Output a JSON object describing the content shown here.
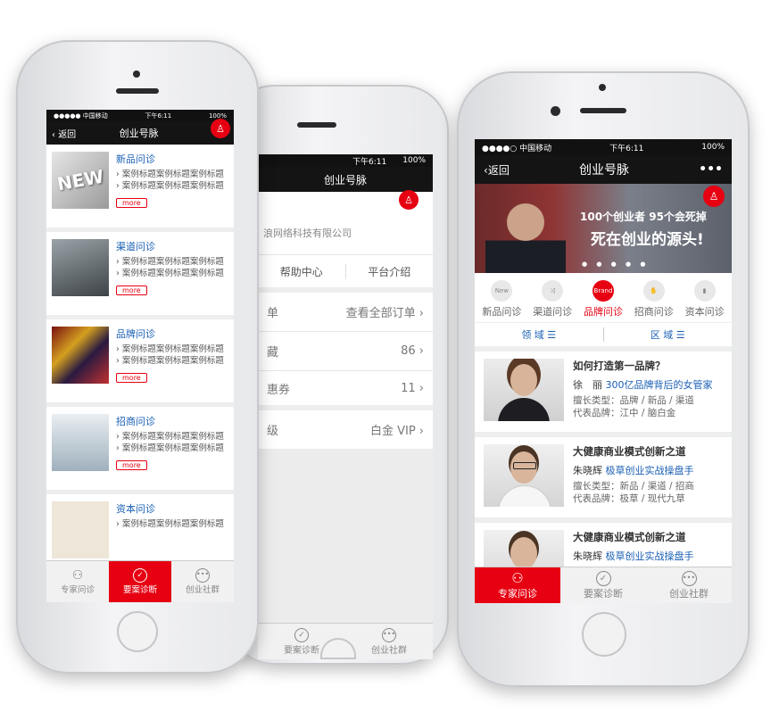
{
  "left_phone": {
    "status": {
      "carrier": "●●●●● 中国移动 ",
      "time": "下午6:11",
      "battery": "100%"
    },
    "nav": {
      "back": "返回",
      "title": "创业号脉"
    },
    "items": [
      {
        "title": "新品问诊",
        "lines": [
          "› 案例标题案例标题案例标题",
          "› 案例标题案例标题案例标题"
        ],
        "more": "more"
      },
      {
        "title": "渠道问诊",
        "lines": [
          "› 案例标题案例标题案例标题",
          "› 案例标题案例标题案例标题"
        ],
        "more": "more"
      },
      {
        "title": "品牌问诊",
        "lines": [
          "› 案例标题案例标题案例标题",
          "› 案例标题案例标题案例标题"
        ],
        "more": "more"
      },
      {
        "title": "招商问诊",
        "lines": [
          "› 案例标题案例标题案例标题",
          "› 案例标题案例标题案例标题"
        ],
        "more": "more"
      },
      {
        "title": "资本问诊",
        "lines": [
          "› 案例标题案例标题案例标题"
        ],
        "more": "more"
      }
    ],
    "tabs": [
      {
        "label": "专家问诊",
        "icon": "experts-icon"
      },
      {
        "label": "要案诊断",
        "icon": "check-icon"
      },
      {
        "label": "创业社群",
        "icon": "chat-icon"
      }
    ]
  },
  "mid_phone": {
    "status": {
      "time": "下午6:11",
      "battery": "100%"
    },
    "nav": {
      "title": "创业号脉"
    },
    "company": "浪网络科技有限公司",
    "links": [
      "帮助中心",
      "平台介绍"
    ],
    "rows": [
      {
        "left": "单",
        "right": "查看全部订单"
      },
      {
        "left": "藏",
        "right": "86"
      },
      {
        "left": "惠券",
        "right": "11"
      },
      {
        "left": "级",
        "right": "白金 VIP"
      }
    ],
    "tabs": [
      {
        "label": "要案诊断",
        "icon": "check-icon"
      },
      {
        "label": "创业社群",
        "icon": "chat-icon"
      }
    ]
  },
  "right_phone": {
    "status": {
      "carrier": "●●●●○ 中国移动",
      "time": "下午6:11",
      "battery": "100%"
    },
    "nav": {
      "back": "返回",
      "title": "创业号脉",
      "menu": "•••"
    },
    "banner": {
      "line1": "100个创业者 95个会死掉",
      "line2": "死在创业的源头!"
    },
    "categories": [
      {
        "label": "新品问诊",
        "icon": "New"
      },
      {
        "label": "渠道问诊",
        "icon": "⤨"
      },
      {
        "label": "品牌问诊",
        "icon": "Brand"
      },
      {
        "label": "招商问诊",
        "icon": "✋"
      },
      {
        "label": "资本问诊",
        "icon": "▮"
      }
    ],
    "active_category": 2,
    "filters": [
      "领 域 ☰",
      "区 域 ☰"
    ],
    "experts": [
      {
        "question": "如何打造第一品牌？",
        "name": "徐　丽",
        "tagline": "300亿品牌背后的女管家",
        "skills": "擅长类型：品牌 / 新品 / 渠道",
        "brands": "代表品牌：江中 / 脑白金"
      },
      {
        "question": "大健康商业模式创新之道",
        "name": "朱晓辉",
        "tagline": "极草创业实战操盘手",
        "skills": "擅长类型：新品 / 渠道 / 招商",
        "brands": "代表品牌：极草 / 现代九草"
      },
      {
        "question": "大健康商业模式创新之道",
        "name": "朱晓辉",
        "tagline": "极草创业实战操盘手",
        "skills": "",
        "brands": ""
      }
    ],
    "tabs": [
      {
        "label": "专家问诊",
        "icon": "experts-icon"
      },
      {
        "label": "要案诊断",
        "icon": "check-icon"
      },
      {
        "label": "创业社群",
        "icon": "chat-icon"
      }
    ]
  },
  "colors": {
    "accent": "#e60012",
    "link": "#1a5fb4",
    "navbar": "#141414"
  }
}
